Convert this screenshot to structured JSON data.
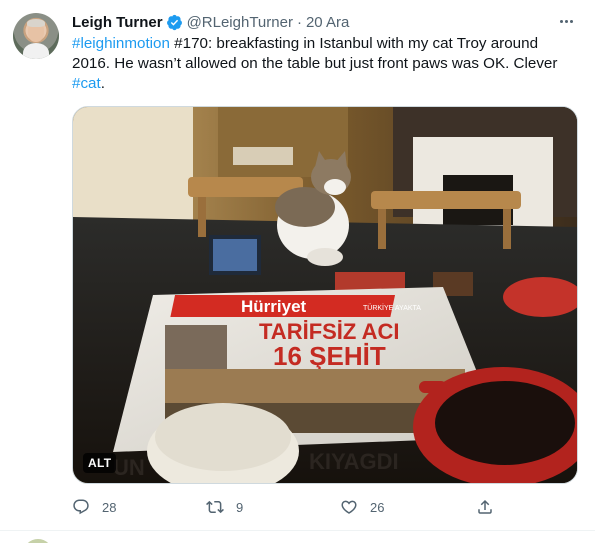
{
  "tweet": {
    "author_name": "Leigh Turner",
    "handle": "@RLeighTurner",
    "separator": "·",
    "date": "20 Ara",
    "text_parts": {
      "hashtag1": "#leighinmotion",
      "part1": " #170: breakfasting in Istanbul with my cat Troy around 2016. He wasn’t allowed on the table but just front paws was OK. Clever ",
      "hashtag2": "#cat",
      "part2": "."
    },
    "media": {
      "alt_badge": "ALT",
      "newspaper": {
        "masthead": "Hürriyet",
        "tagline": "TÜRKİYE AYAKTA",
        "headline1": "TARİFSİZ ACI",
        "headline2": "16 ŞEHİT",
        "footer_word1": "UN",
        "footer_word2": "KIYAGDI"
      }
    },
    "actions": {
      "reply_count": "28",
      "retweet_count": "9",
      "like_count": "26"
    }
  },
  "colors": {
    "link": "#1d9bf0",
    "muted": "#536471",
    "text": "#0f1419",
    "verified": "#1d9bf0"
  },
  "icons": [
    "verified-badge-icon",
    "more-icon",
    "reply-icon",
    "retweet-icon",
    "like-icon",
    "share-icon"
  ]
}
